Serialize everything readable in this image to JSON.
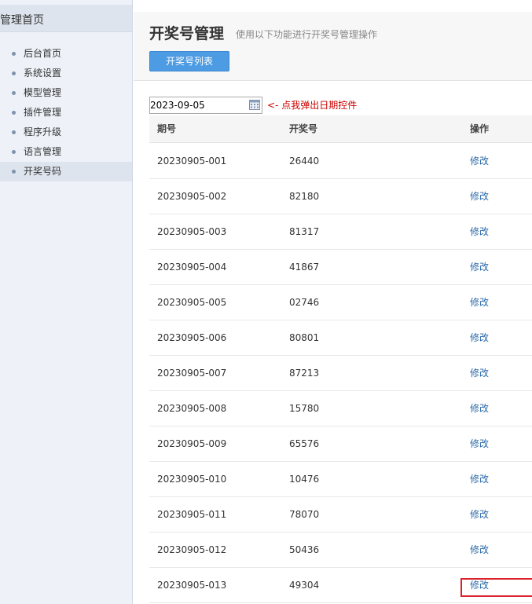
{
  "sidebar": {
    "header": "管理首页",
    "items": [
      {
        "label": "后台首页"
      },
      {
        "label": "系统设置"
      },
      {
        "label": "模型管理"
      },
      {
        "label": "插件管理"
      },
      {
        "label": "程序升级"
      },
      {
        "label": "语言管理"
      },
      {
        "label": "开奖号码"
      }
    ],
    "active_index": 6
  },
  "header": {
    "title": "开奖号管理",
    "subtitle": "使用以下功能进行开奖号管理操作",
    "list_button": "开奖号列表"
  },
  "filter": {
    "date_value": "2023-09-05",
    "hint": "<- 点我弹出日期控件"
  },
  "table": {
    "columns": [
      "期号",
      "开奖号",
      "操作"
    ],
    "action_label": "修改",
    "rows": [
      {
        "issue": "20230905-001",
        "number": "26440"
      },
      {
        "issue": "20230905-002",
        "number": "82180"
      },
      {
        "issue": "20230905-003",
        "number": "81317"
      },
      {
        "issue": "20230905-004",
        "number": "41867"
      },
      {
        "issue": "20230905-005",
        "number": "02746"
      },
      {
        "issue": "20230905-006",
        "number": "80801"
      },
      {
        "issue": "20230905-007",
        "number": "87213"
      },
      {
        "issue": "20230905-008",
        "number": "15780"
      },
      {
        "issue": "20230905-009",
        "number": "65576"
      },
      {
        "issue": "20230905-010",
        "number": "10476"
      },
      {
        "issue": "20230905-011",
        "number": "78070"
      },
      {
        "issue": "20230905-012",
        "number": "50436"
      },
      {
        "issue": "20230905-013",
        "number": "49304"
      }
    ],
    "highlighted_row_index": 12
  },
  "colors": {
    "accent_button": "#4d9be3",
    "link": "#2b6aa8",
    "hint_text": "#cc0000",
    "highlight_border": "#d9232d",
    "sidebar_bg": "#eef2f8"
  },
  "icons": {
    "menu_bullet": "bullet-icon",
    "date_picker": "calendar-icon"
  }
}
